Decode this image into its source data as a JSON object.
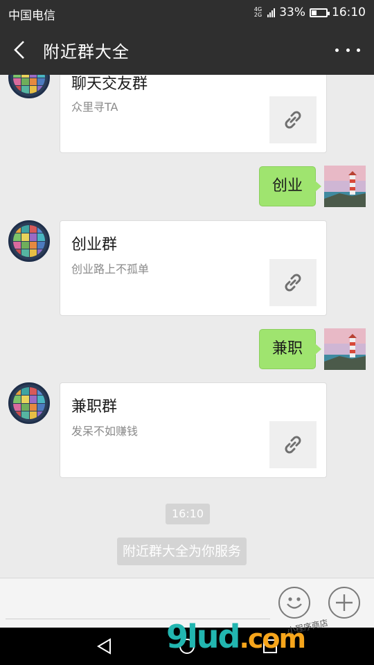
{
  "status": {
    "carrier": "中国电信",
    "net_top": "4G",
    "net_bottom": "2G",
    "battery": "33%",
    "battery_level": 0.33,
    "time": "16:10"
  },
  "header": {
    "title": "附近群大全"
  },
  "messages": [
    {
      "type": "card",
      "title": "聊天交友群",
      "desc": "众里寻TA"
    },
    {
      "type": "sent",
      "text": "创业"
    },
    {
      "type": "card",
      "title": "创业群",
      "desc": "创业路上不孤单"
    },
    {
      "type": "sent",
      "text": "兼职"
    },
    {
      "type": "card",
      "title": "兼职群",
      "desc": "发呆不如赚钱"
    }
  ],
  "timestamp": "16:10",
  "system_notice": "附近群大全为你服务",
  "watermark": {
    "main": "9lud",
    "suffix": ".com",
    "sub": "小程序商店"
  },
  "colors": {
    "header_bg": "#2f2f2f",
    "bubble_green": "#9fe46f",
    "chat_bg": "#ebebeb"
  },
  "icons": [
    "back-arrow-icon",
    "more-dots-icon",
    "link-icon",
    "emoji-icon",
    "plus-icon",
    "nav-back-icon",
    "nav-home-icon",
    "nav-recents-icon"
  ]
}
